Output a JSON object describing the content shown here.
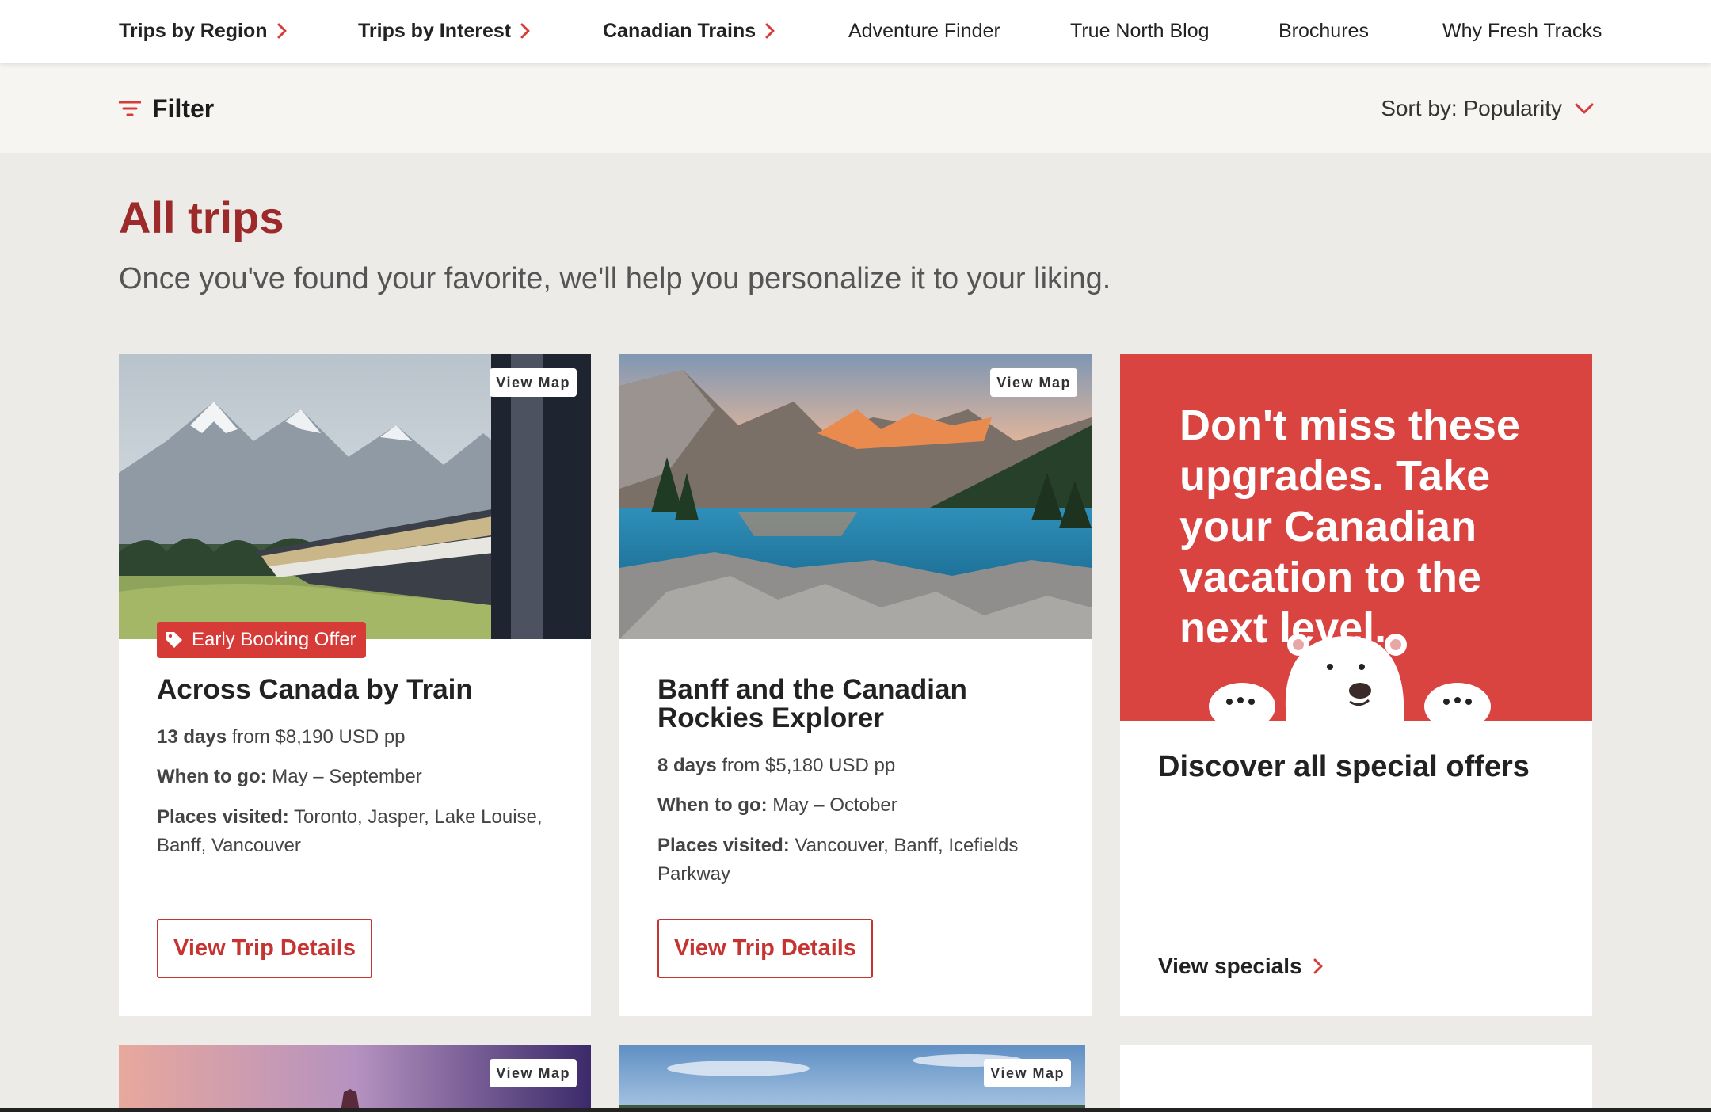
{
  "nav": {
    "items": [
      {
        "label": "Trips by Region",
        "has_chevron": true
      },
      {
        "label": "Trips by Interest",
        "has_chevron": true
      },
      {
        "label": "Canadian Trains",
        "has_chevron": true
      },
      {
        "label": "Adventure Finder",
        "has_chevron": false
      },
      {
        "label": "True North Blog",
        "has_chevron": false
      },
      {
        "label": "Brochures",
        "has_chevron": false
      },
      {
        "label": "Why Fresh Tracks",
        "has_chevron": false
      }
    ]
  },
  "filterbar": {
    "filter_label": "Filter",
    "sort_label": "Sort by: Popularity"
  },
  "page": {
    "title": "All trips",
    "subtitle": "Once you've found your favorite, we'll help you personalize it to your liking."
  },
  "cards": [
    {
      "view_map": "View Map",
      "badge": "Early Booking Offer",
      "title": "Across Canada by Train",
      "days": "13 days",
      "price": "from $8,190 USD pp",
      "when_label": "When to go:",
      "when_value": "May – September",
      "places_label": "Places visited:",
      "places_value": "Toronto, Jasper, Lake Louise, Banff, Vancouver",
      "button": "View Trip Details"
    },
    {
      "view_map": "View Map",
      "title_line1": "Banff and the Canadian",
      "title_line2": "Rockies Explorer",
      "days": "8 days",
      "price": "from $5,180 USD pp",
      "when_label": "When to go:",
      "when_value": "May – October",
      "places_label": "Places visited:",
      "places_value": "Vancouver, Banff, Icefields Parkway",
      "button": "View Trip Details"
    }
  ],
  "promo": {
    "headline": "Don't miss these upgrades. Take your Canadian vacation to the next level.",
    "offers_title": "Discover all special offers",
    "link_label": "View specials"
  },
  "next_row": {
    "view_map_1": "View Map",
    "view_map_2": "View Map"
  },
  "colors": {
    "brand_red": "#d94340",
    "title_red": "#9c2a2a",
    "button_red": "#c63431",
    "page_bg": "#edebe7"
  }
}
